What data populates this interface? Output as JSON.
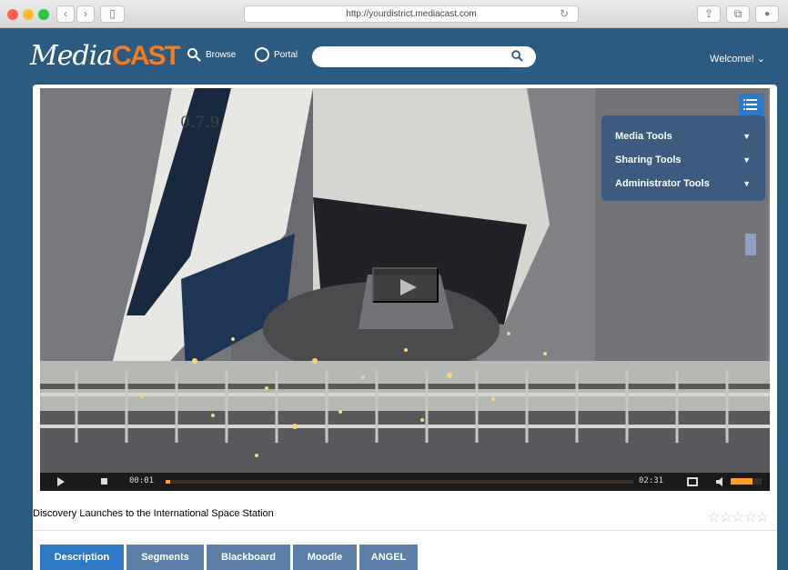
{
  "browser": {
    "url": "http://yourdistrict.mediacast.com",
    "reload_glyph": "↻",
    "left_nav_glyph": "‹",
    "right_nav_glyph": "›",
    "tab_glyph": "▯",
    "share_glyph": "⇪",
    "tabs_glyph": "⧉",
    "extension_glyph": "●"
  },
  "header": {
    "logo_main": "Media",
    "logo_accent": "CAST",
    "browse": "Browse",
    "portal": "Portal",
    "welcome": "Welcome!",
    "welcome_chevron": "⌄"
  },
  "search": {
    "placeholder": ""
  },
  "video": {
    "timestamp": "0.7.9",
    "current_time": "00:01",
    "duration": "02:31",
    "progress": 0.01,
    "volume_level": 0.72
  },
  "tools": {
    "items": [
      {
        "label": "Media Tools",
        "caret": "▼"
      },
      {
        "label": "Sharing Tools",
        "caret": "▼"
      },
      {
        "label": "Administrator Tools",
        "caret": "▼"
      }
    ]
  },
  "media": {
    "title": "Discovery Launches to the International Space Station",
    "stars": "☆☆☆☆☆"
  },
  "tabs": [
    {
      "label": "Description"
    },
    {
      "label": "Segments"
    },
    {
      "label": "Blackboard"
    },
    {
      "label": "Moodle"
    },
    {
      "label": "ANGEL"
    }
  ],
  "colors": {
    "brand_blue": "#2d5a80",
    "accent_orange": "#f47b20",
    "tab_active": "#2f78c4"
  }
}
